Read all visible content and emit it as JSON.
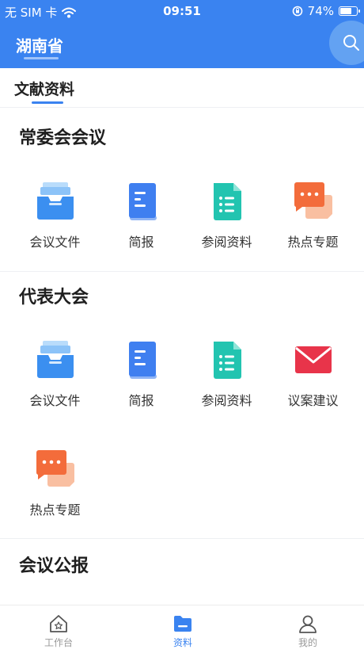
{
  "status_bar": {
    "carrier": "无 SIM 卡",
    "time": "09:51",
    "battery": "74%",
    "battery_level": 0.74
  },
  "header": {
    "title": "湖南省",
    "search_icon": "search-icon"
  },
  "tabs": {
    "active": "文献资料"
  },
  "sections": {
    "standing_committee": {
      "title": "常委会会议",
      "items": [
        "会议文件",
        "简报",
        "参阅资料",
        "热点专题"
      ]
    },
    "congress": {
      "title": "代表大会",
      "items": [
        "会议文件",
        "简报",
        "参阅资料",
        "议案建议",
        "热点专题"
      ]
    },
    "bulletin": {
      "title": "会议公报"
    }
  },
  "bottom_nav": {
    "items": [
      {
        "label": "工作台",
        "icon": "home-icon"
      },
      {
        "label": "资料",
        "icon": "folder-icon"
      },
      {
        "label": "我的",
        "icon": "user-icon"
      }
    ],
    "active_index": 1
  },
  "colors": {
    "primary": "#3a83f0",
    "folder_blue": "#3b8ff0",
    "doc_teal": "#22c4b0",
    "chat_orange": "#f36c3b",
    "mail_red": "#e8344a"
  }
}
